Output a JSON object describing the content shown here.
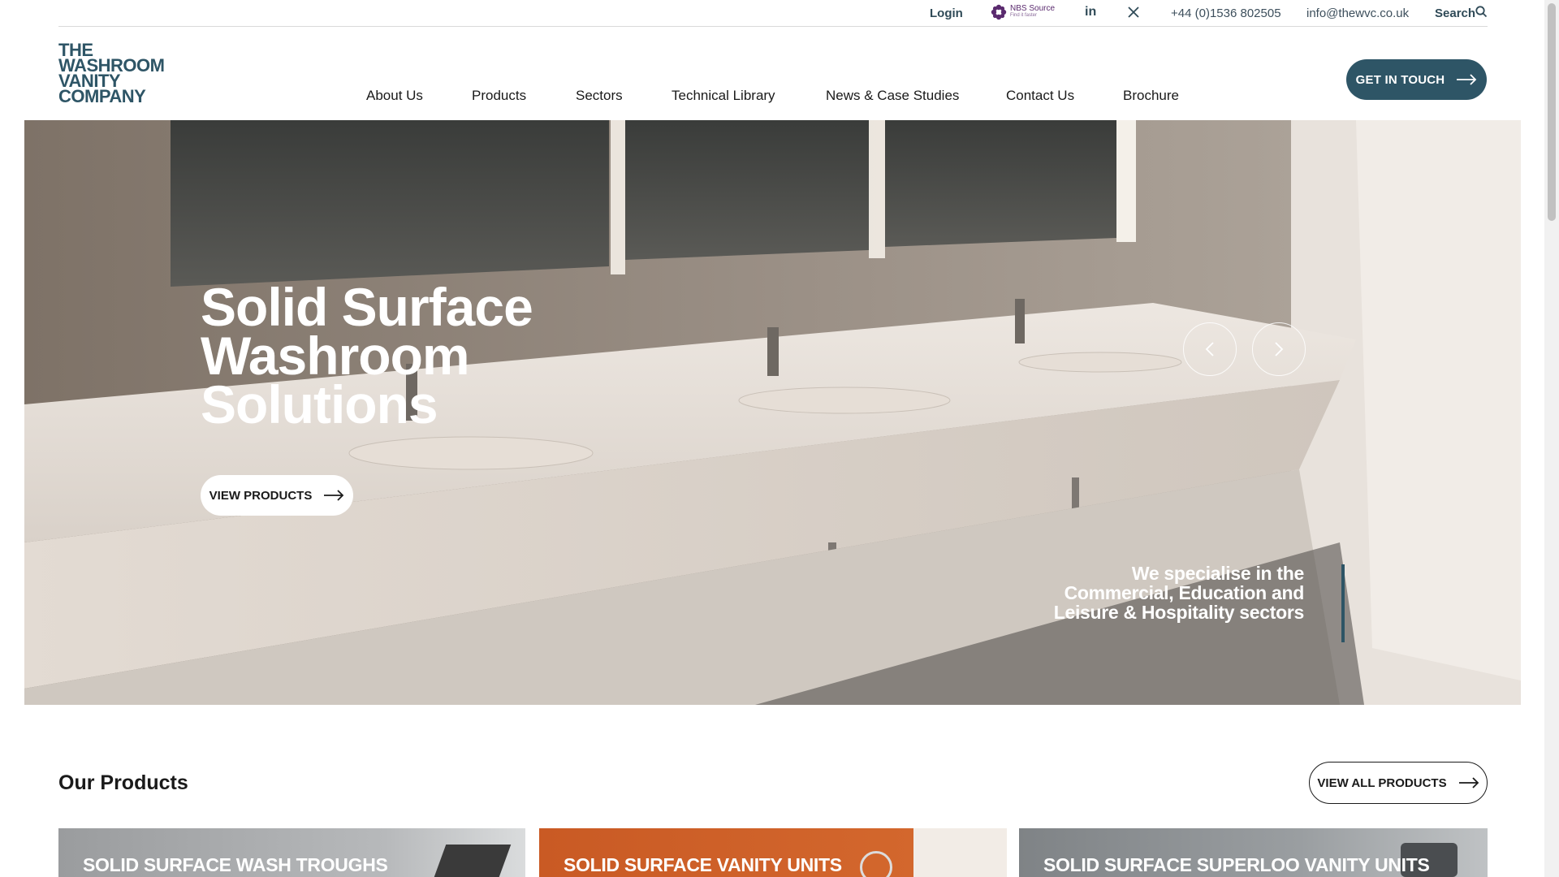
{
  "topbar": {
    "login": "Login",
    "nbs_label": "NBS Source",
    "nbs_sub": "Find it faster",
    "phone": "+44 (0)1536 802505",
    "email": "info@thewvc.co.uk",
    "search": "Search"
  },
  "logo": {
    "line1": "THE",
    "line2": "WASHROOM",
    "line3": "VANITY",
    "line4": "COMPANY"
  },
  "nav": {
    "items": [
      "About Us",
      "Products",
      "Sectors",
      "Technical Library",
      "News & Case Studies",
      "Contact Us",
      "Brochure"
    ]
  },
  "cta": {
    "label": "GET IN TOUCH"
  },
  "hero": {
    "title_line1": "Solid Surface",
    "title_line2": "Washroom",
    "title_line3": "Solutions",
    "button": "VIEW PRODUCTS",
    "tagline": "We specialise in the Commercial, Education and Leisure & Hospitality sectors"
  },
  "products": {
    "title": "Our Products",
    "view_all": "VIEW ALL PRODUCTS",
    "cards": [
      {
        "label": "SOLID SURFACE WASH TROUGHS",
        "color": "#9a9c9e"
      },
      {
        "label": "SOLID SURFACE VANITY UNITS",
        "color": "#c95a24"
      },
      {
        "label": "SOLID SURFACE SUPERLOO VANITY UNITS",
        "color": "#7f8386"
      }
    ]
  },
  "colors": {
    "brand": "#2e5566",
    "accent_orange": "#c95a24"
  }
}
